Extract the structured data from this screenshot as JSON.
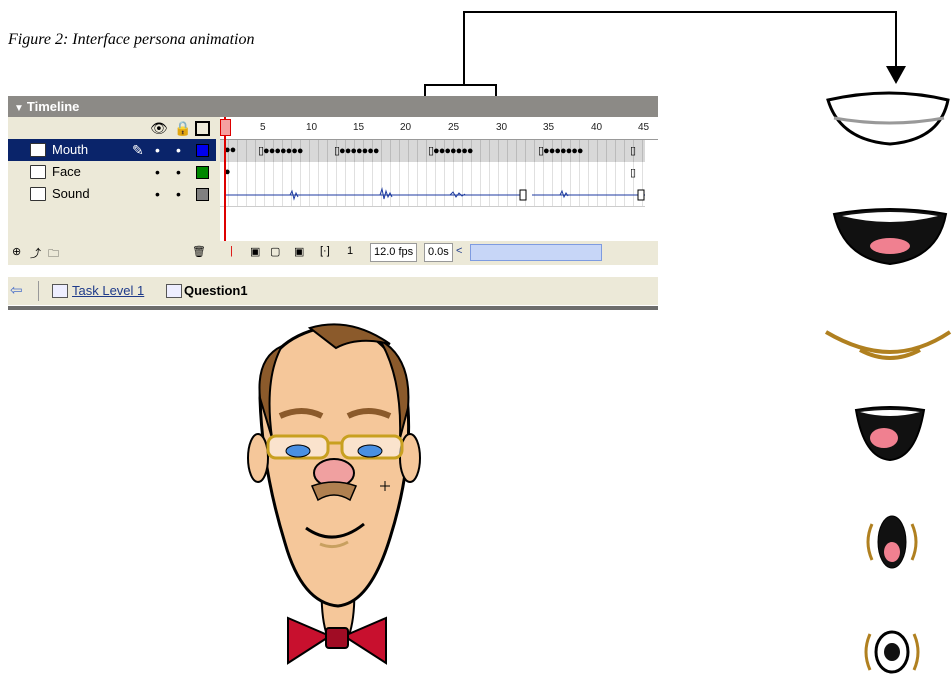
{
  "caption": "Figure 2: Interface persona animation",
  "timeline": {
    "header_label": "Timeline",
    "ruler_ticks": [
      "1",
      "5",
      "10",
      "15",
      "20",
      "25",
      "30",
      "35",
      "40",
      "45"
    ],
    "layers": [
      {
        "name": "Mouth",
        "selected": true,
        "color": "#0000ee"
      },
      {
        "name": "Face",
        "selected": false,
        "color": "#008800"
      },
      {
        "name": "Sound",
        "selected": false,
        "color": "#808080"
      }
    ],
    "frame_number": "1",
    "fps": "12.0 fps",
    "elapsed": "0.0s"
  },
  "breadcrumb": {
    "task": "Task Level 1",
    "question": "Question1"
  },
  "colors": {
    "panel_bg": "#ece9d8",
    "header_bg": "#8c8a86",
    "selected_layer": "#0a246a",
    "tie": "#c8102e",
    "skin": "#f5c79a",
    "hair": "#8b5a2b"
  }
}
